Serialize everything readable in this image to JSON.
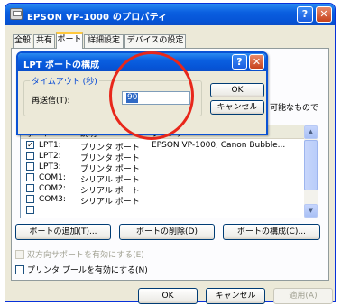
{
  "window": {
    "title": "EPSON VP-1000 のプロパティ",
    "help_glyph": "?",
    "close_glyph": "✕"
  },
  "tabs": [
    "全般",
    "共有",
    "ポート",
    "詳細設定",
    "デバイスの設定"
  ],
  "background_text": {
    "fragment": "可能なもので"
  },
  "dialog": {
    "title": "LPT ポートの構成",
    "help_glyph": "?",
    "close_glyph": "✕",
    "group_label": "タイムアウト (秒)",
    "retry_label": "再送信(T):",
    "retry_value": "90",
    "ok_label": "OK",
    "cancel_label": "キャンセル"
  },
  "port_list": {
    "columns": [
      "ポート",
      "説明",
      "プリンタ"
    ],
    "rows": [
      {
        "checked": true,
        "port": "LPT1:",
        "desc": "プリンタ ポート",
        "printer": "EPSON VP-1000, Canon Bubble..."
      },
      {
        "checked": false,
        "port": "LPT2:",
        "desc": "プリンタ ポート",
        "printer": ""
      },
      {
        "checked": false,
        "port": "LPT3:",
        "desc": "プリンタ ポート",
        "printer": ""
      },
      {
        "checked": false,
        "port": "COM1:",
        "desc": "シリアル ポート",
        "printer": ""
      },
      {
        "checked": false,
        "port": "COM2:",
        "desc": "シリアル ポート",
        "printer": ""
      },
      {
        "checked": false,
        "port": "COM3:",
        "desc": "シリアル ポート",
        "printer": ""
      }
    ],
    "check_glyph": "✓",
    "scroll_up_glyph": "▲",
    "scroll_down_glyph": "▼"
  },
  "port_buttons": {
    "add": "ポートの追加(T)...",
    "delete": "ポートの削除(D)",
    "configure": "ポートの構成(C)..."
  },
  "options": {
    "bidirectional": "双方向サポートを有効にする(E)",
    "pooling": "プリンタ プールを有効にする(N)"
  },
  "footer": {
    "ok": "OK",
    "cancel": "キャンセル",
    "apply": "適用(A)"
  },
  "annotation": {
    "circle_color": "#e8271b"
  }
}
